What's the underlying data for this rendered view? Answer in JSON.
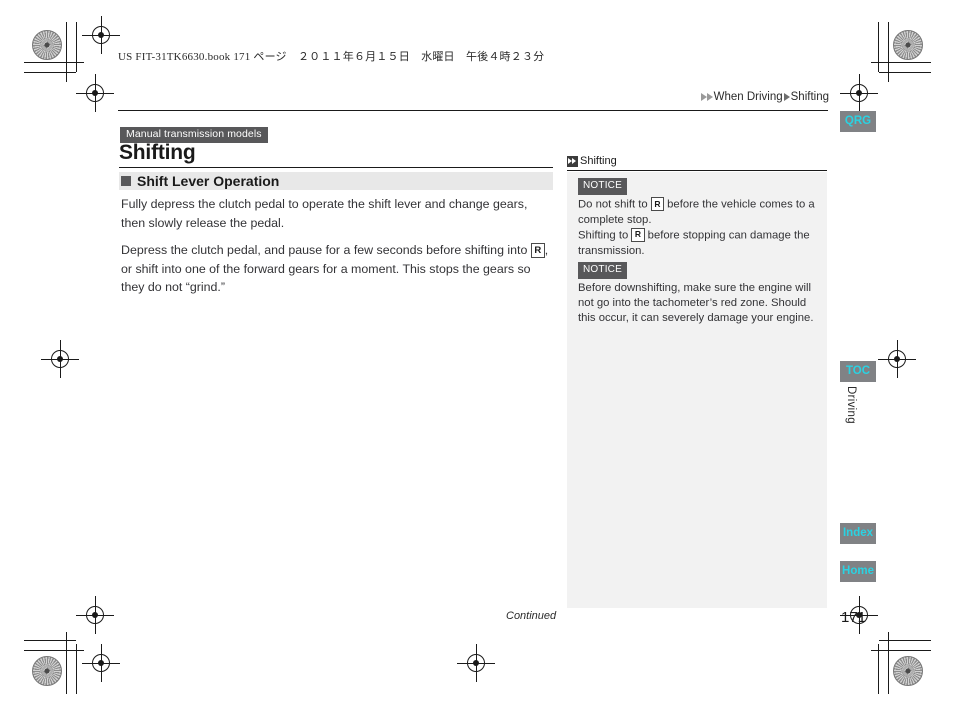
{
  "print_marks": {
    "book_line": "US FIT-31TK6630.book   171 ページ　２０１１年６月１５日　水曜日　午後４時２３分"
  },
  "breadcrumb": {
    "segments": [
      "When Driving",
      "Shifting"
    ]
  },
  "left_column": {
    "model_badge": "Manual transmission models",
    "title": "Shifting",
    "section_heading": "Shift Lever Operation",
    "paragraph_1": "Fully depress the clutch pedal to operate the shift lever and change gears, then slowly release the pedal.",
    "paragraph_2_a": "Depress the clutch pedal, and pause for a few seconds before shifting into",
    "paragraph_2_gear": "R",
    "paragraph_2_b": ", or shift into one of the forward gears for a moment. This stops the gears so they do not “grind.”"
  },
  "sidebar": {
    "header": "Shifting",
    "notices": [
      {
        "tag": "NOTICE",
        "line_a": "Do not shift to",
        "gear_1": "R",
        "line_b": "before the vehicle comes to a complete stop.",
        "line_c": "Shifting to",
        "gear_2": "R",
        "line_d": "before stopping can damage the transmission."
      },
      {
        "tag": "NOTICE",
        "text": "Before downshifting, make sure the engine will not go into the tachometer’s red zone. Should this occur, it can severely damage your engine."
      }
    ]
  },
  "tabs": {
    "qrg": "QRG",
    "toc": "TOC",
    "index": "Index",
    "home": "Home",
    "section_label": "Driving"
  },
  "footer": {
    "continued": "Continued",
    "page_number": "171"
  },
  "colors": {
    "tab_background": "#808285",
    "tab_text": "#2ad2e2",
    "badge_background": "#58585a",
    "section_band": "#e8e8e8",
    "panel_background": "#f2f2f2"
  }
}
